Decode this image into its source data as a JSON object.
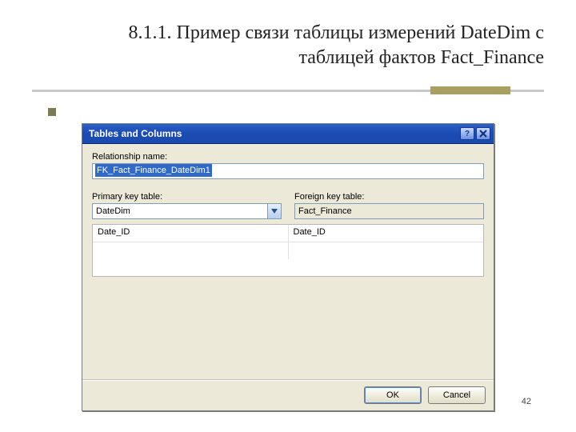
{
  "slide": {
    "title": "8.1.1. Пример связи таблицы измерений DateDim с таблицей фактов Fact_Finance",
    "page_number": "42"
  },
  "dialog": {
    "title": "Tables and Columns",
    "labels": {
      "relationship_name": "Relationship name:",
      "primary_key_table": "Primary key table:",
      "foreign_key_table": "Foreign key table:"
    },
    "relationship_name_value": "FK_Fact_Finance_DateDim1",
    "primary_key_table": "DateDim",
    "foreign_key_table": "Fact_Finance",
    "grid": {
      "rows": [
        {
          "left": "Date_ID",
          "right": "Date_ID"
        },
        {
          "left": "",
          "right": ""
        }
      ]
    },
    "buttons": {
      "ok": "OK",
      "cancel": "Cancel"
    }
  }
}
